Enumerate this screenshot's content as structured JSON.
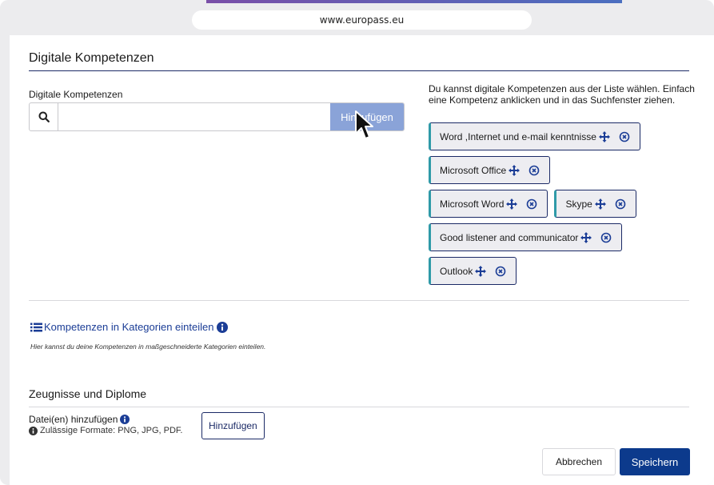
{
  "browser": {
    "url": "www.europass.eu"
  },
  "digital_skills": {
    "section_title": "Digitale Kompetenzen",
    "field_label": "Digitale Kompetenzen",
    "search_value": "",
    "search_placeholder": "",
    "add_button_label": "Hinzufügen",
    "help_text": "Du kannst digitale Kompetenzen aus der Liste wählen. Einfach eine Kompetenz anklicken und in das Suchfenster ziehen.",
    "tags": [
      "Word ,Internet und e-mail kenntnisse",
      "Microsoft Office",
      "Microsoft Word",
      "Skype",
      "Good listener and communicator",
      "Outlook"
    ],
    "categories_link": "Kompetenzen in Kategorien einteilen",
    "categories_desc": "Hier kannst du deine Kompetenzen in maßgeschneiderte Kategorien einteilen."
  },
  "certificates": {
    "section_title": "Zeugnisse und Diplome",
    "file_label": "Datei(en) hinzufügen",
    "formats_text": "Zulässige Formate: PNG, JPG, PDF.",
    "upload_button": "Hinzufügen"
  },
  "footer": {
    "cancel_label": "Abbrechen",
    "save_label": "Speichern"
  },
  "colors": {
    "primary": "#0c3a8c",
    "link": "#1b3d96",
    "disabled_button": "#8aa3d8",
    "tag_accent": "#2f9aa8"
  },
  "icons": {
    "search": "search-icon",
    "move": "move-icon",
    "remove": "remove-icon",
    "info": "info-icon",
    "list": "list-icon",
    "cursor": "cursor-icon"
  }
}
